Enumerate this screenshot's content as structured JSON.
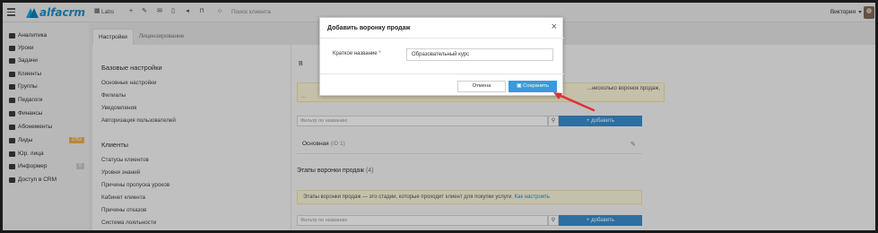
{
  "topbar": {
    "brand": "alfacrm",
    "labs": "Labs",
    "search_placeholder": "Поиск клиента",
    "user_name": "Виктория"
  },
  "sidebar": {
    "items": [
      {
        "label": "Аналитика",
        "icon": "chart-icon"
      },
      {
        "label": "Уроки",
        "icon": "calendar-icon"
      },
      {
        "label": "Задачи",
        "icon": "tasks-icon"
      },
      {
        "label": "Клиенты",
        "icon": "user-icon"
      },
      {
        "label": "Группы",
        "icon": "users-icon"
      },
      {
        "label": "Педагоги",
        "icon": "teacher-icon"
      },
      {
        "label": "Финансы",
        "icon": "money-icon"
      },
      {
        "label": "Абонементы",
        "icon": "ticket-icon"
      },
      {
        "label": "Лиды",
        "icon": "leads-icon",
        "badge": "1752"
      },
      {
        "label": "Юр. лица",
        "icon": "building-icon"
      },
      {
        "label": "Информер",
        "icon": "informer-icon",
        "badge": "0"
      },
      {
        "label": "Доступ в CRM",
        "icon": "lock-icon"
      }
    ]
  },
  "tabs": [
    {
      "label": "Настройки"
    },
    {
      "label": "Лицензирование"
    }
  ],
  "settings": {
    "base_title": "Базовые настройки",
    "base_links": [
      "Основные настройки",
      "Филиалы",
      "Уведомления",
      "Авторизация пользователей"
    ],
    "clients_title": "Клиенты",
    "clients_links": [
      "Статусы клиентов",
      "Уровни знаний",
      "Причины пропуска уроков",
      "Кабинет клиента",
      "Причины отказов",
      "Система лояльности"
    ]
  },
  "funnels": {
    "heading_letter": "В",
    "info_text": "...несколько воронок продаж,",
    "info_text_2": "...",
    "filter_placeholder": "Фильтр по названию",
    "add_label": "+ добавить",
    "row_name": "Основная",
    "row_count": "(ID 1)"
  },
  "stages": {
    "title": "Этапы воронки продаж",
    "count": "(4)",
    "info_text": "Этапы воронки продаж — это стадии, которые проходит клиент для покупки услуги.",
    "info_link": "Как настроить",
    "filter_placeholder": "Фильтр по названию",
    "add_label": "+ добавить"
  },
  "modal": {
    "title": "Добавить воронку продаж",
    "field_label": "Краткое название",
    "required_mark": "*",
    "field_value": "Образовательный курс",
    "cancel_label": "Отмена",
    "save_label": "Сохранить"
  },
  "colors": {
    "accent": "#3a9ad9",
    "annotation_arrow": "#e03131",
    "info_bg": "#fdf7d9"
  }
}
